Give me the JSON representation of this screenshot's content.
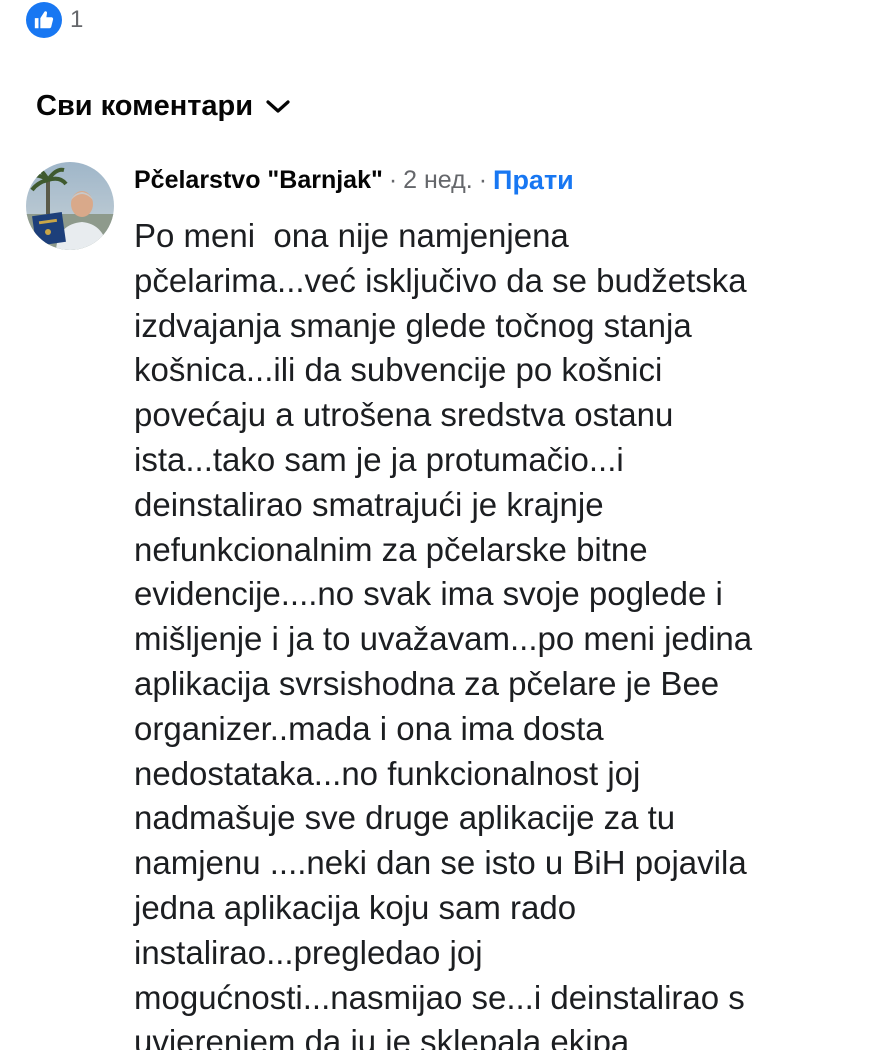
{
  "reactions": {
    "icon": "like-icon",
    "count": "1",
    "color": "#1877f2"
  },
  "filter": {
    "label": "Сви коментари",
    "icon": "chevron-down-icon"
  },
  "comment": {
    "author": "Pčelarstvo  \"Barnjak\"",
    "separator": "·",
    "time": "2 нед.",
    "follow_label": "Прати",
    "text": "Po meni  ona nije namjenjena\npčelarima...već isključivo da se budžetska\nizdvajanja smanje glede točnog stanja\nkošnica...ili da subvencije po košnici\npovećaju a utrošena sredstva ostanu\nista...tako sam je ja protumačio...i\ndeinstalirao smatrajući je krajnje\nnefunkcionalnim za pčelarske bitne\nevidencije....no svak ima svoje poglede i\nmišljenje i ja to uvažavam...po meni jedina\naplikacija svrsishodna za pčelare je Bee\norganizer..mada i ona ima dosta\nnedostataka...no funkcionalnost joj\nnadmašuje sve druge aplikacije za tu\nnamjenu ....neki dan se isto u BiH pojavila\njedna aplikacija koju sam rado\ninstalirao...pregledao joj\nmogućnosti...nasmijao se...i deinstalirao s\nuvjerenjem da ju je sklepala ekipa"
  },
  "colors": {
    "link": "#1877f2",
    "secondary_text": "#65676b",
    "primary_text": "#050505"
  }
}
